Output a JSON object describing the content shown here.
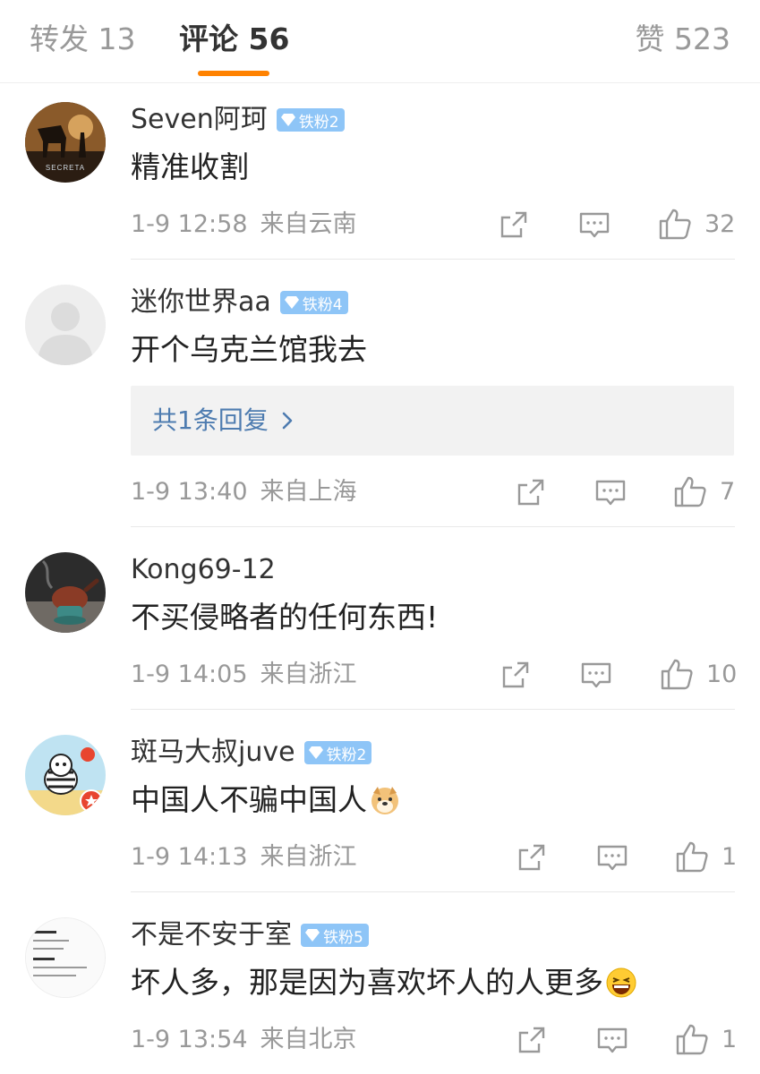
{
  "tabs": {
    "repost_label": "转发 13",
    "comments_label": "评论 56",
    "likes_label": "赞 523",
    "active_color": "#ff8200"
  },
  "comments": [
    {
      "username": "Seven阿珂",
      "badge": "铁粉2",
      "avatar_icon": "horse-photo-avatar",
      "avatar_caption": "SECRETA",
      "text": "精准收割",
      "time": "1-9 12:58",
      "location": "来自云南",
      "likes": "32"
    },
    {
      "username": "迷你世界aa",
      "badge": "铁粉4",
      "avatar_icon": "default-avatar",
      "text": "开个乌克兰馆我去",
      "reply_summary": "共1条回复",
      "time": "1-9 13:40",
      "location": "来自上海",
      "likes": "7"
    },
    {
      "username": "Kong69-12",
      "avatar_icon": "teapot-photo-avatar",
      "text": "不买侵略者的任何东西!",
      "time": "1-9 14:05",
      "location": "来自浙江",
      "likes": "10"
    },
    {
      "username": "斑马大叔juve",
      "badge": "铁粉2",
      "avatar_icon": "zebra-cartoon-avatar",
      "text": "中国人不骗中国人",
      "emoji": "doge-emoji",
      "time": "1-9 14:13",
      "location": "来自浙江",
      "likes": "1"
    },
    {
      "username": "不是不安于室",
      "badge": "铁粉5",
      "avatar_icon": "text-document-avatar",
      "text": "坏人多，那是因为喜欢坏人的人更多",
      "emoji": "laughing-emoji",
      "time": "1-9 13:54",
      "location": "来自北京",
      "likes": "1"
    }
  ],
  "colors": {
    "badge_bg": "#8ec5f7",
    "reply_link": "#4e7cb0",
    "meta_gray": "#999999"
  }
}
